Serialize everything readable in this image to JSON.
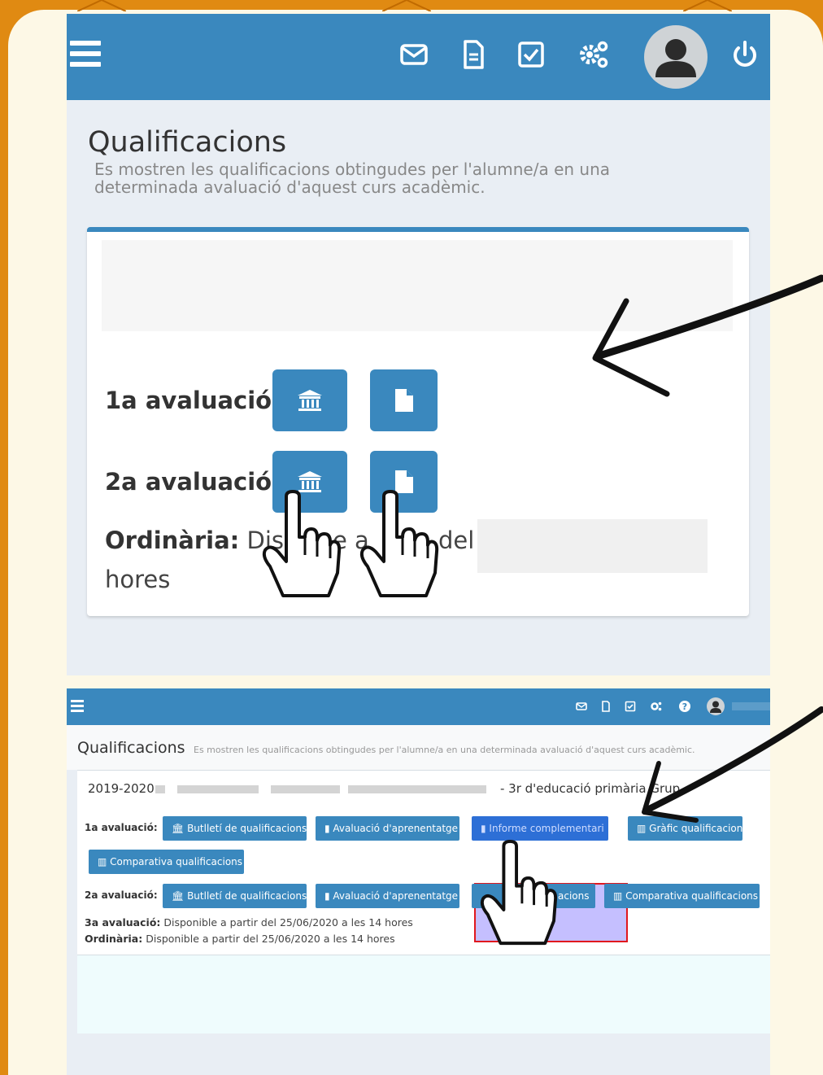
{
  "screen_top": {
    "title": "Qualificacions",
    "subtitle": "Es mostren les qualificacions obtingudes per l'alumne/a en una determinada avaluació d'aquest curs acadèmic.",
    "eval_1_label": "1a avaluació:",
    "eval_2_label": "2a avaluació:",
    "ordinaria_label": "Ordinària:",
    "ordinaria_text": " Dis",
    "ordinaria_text_tail": "del",
    "ordinaria_line2": "hores",
    "icons": [
      "menu-icon",
      "envelope-icon",
      "document-icon",
      "checkbox-icon",
      "gears-icon",
      "user-avatar-icon",
      "power-icon"
    ],
    "accent_color": "#3a88be"
  },
  "screen_bottom": {
    "title": "Qualificacions",
    "subtitle": "Es mostren les qualificacions obtingudes per l'alumne/a en una determinada avaluació d'aquest curs acadèmic.",
    "year": "2019-2020",
    "grade": "- 3r d'educació primària  Grup",
    "eval_1_label": "1a avaluació:",
    "eval_2_label": "2a avaluació:",
    "buttons_eval1": {
      "butlleti": "Butlletí de qualificacions",
      "aprenentatge": "Avaluació d'aprenentatge",
      "informe": "Informe complementari",
      "grafic": "Gràfic qualificacions",
      "comparativa": "Comparativa qualificacions"
    },
    "buttons_eval2": {
      "butlleti": "Butlletí de qualificacions",
      "aprenentatge": "Avaluació d'aprenentatge",
      "grafic_tail": "acions",
      "comparativa": "Comparativa qualificacions"
    },
    "eval_3_label": "3a avaluació:",
    "eval_3_text": " Disponible a partir del 25/06/2020 a les 14 hores",
    "ordinaria_label": "Ordinària:",
    "ordinaria_text": " Disponible a partir del 25/06/2020 a les 14 hores",
    "icons": [
      "menu-icon",
      "envelope-icon",
      "document-icon",
      "checkbox-icon",
      "gears-icon",
      "help-icon",
      "user-avatar-icon"
    ]
  },
  "background_color": "#e08a12",
  "highlight_border_color": "#e0181e"
}
